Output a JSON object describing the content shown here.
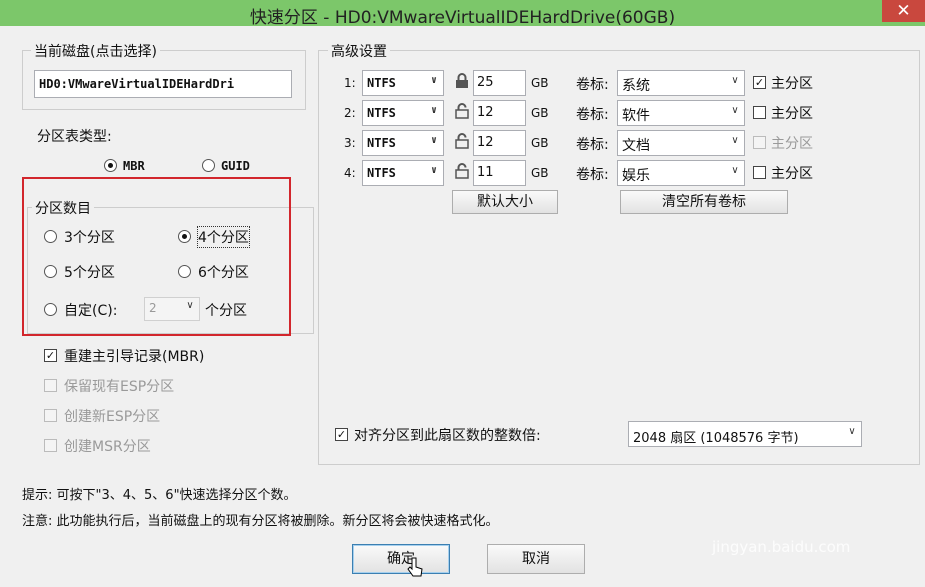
{
  "window": {
    "title": "快速分区 - HD0:VMwareVirtualIDEHardDrive(60GB)",
    "close_glyph": "✕"
  },
  "disk": {
    "legend": "当前磁盘(点击选择)",
    "value": "HD0:VMwareVirtualIDEHardDri"
  },
  "table_type": {
    "label": "分区表类型:",
    "options": [
      "MBR",
      "GUID"
    ],
    "selected": "MBR"
  },
  "count": {
    "legend": "分区数目",
    "opt3": "3个分区",
    "opt4": "4个分区",
    "opt5": "5个分区",
    "opt6": "6个分区",
    "custom": "自定(C):",
    "custom_value": "2",
    "custom_suffix": "个分区",
    "selected": "4个分区"
  },
  "options": {
    "rebuild_mbr": {
      "label": "重建主引导记录(MBR)",
      "checked": true
    },
    "keep_esp": {
      "label": "保留现有ESP分区",
      "checked": false,
      "disabled": true
    },
    "new_esp": {
      "label": "创建新ESP分区",
      "checked": false,
      "disabled": true
    },
    "msr": {
      "label": "创建MSR分区",
      "checked": false,
      "disabled": true
    }
  },
  "advanced": {
    "legend": "高级设置",
    "unit": "GB",
    "volume_label": "卷标:",
    "primary_label": "主分区",
    "rows": [
      {
        "index": "1:",
        "fs": "NTFS",
        "size": "25",
        "label": "系统",
        "primary": true,
        "primary_disabled": false,
        "locked": true
      },
      {
        "index": "2:",
        "fs": "NTFS",
        "size": "12",
        "label": "软件",
        "primary": false,
        "primary_disabled": false,
        "locked": false
      },
      {
        "index": "3:",
        "fs": "NTFS",
        "size": "12",
        "label": "文档",
        "primary": false,
        "primary_disabled": true,
        "locked": false
      },
      {
        "index": "4:",
        "fs": "NTFS",
        "size": "11",
        "label": "娱乐",
        "primary": false,
        "primary_disabled": false,
        "locked": false
      }
    ],
    "default_size_btn": "默认大小",
    "clear_labels_btn": "清空所有卷标",
    "align": {
      "label": "对齐分区到此扇区数的整数倍:",
      "checked": true,
      "value": "2048 扇区 (1048576 字节)"
    }
  },
  "notes": {
    "tip": "提示: 可按下\"3、4、5、6\"快速选择分区个数。",
    "warn": "注意: 此功能执行后，当前磁盘上的现有分区将被删除。新分区将会被快速格式化。"
  },
  "buttons": {
    "ok": "确定",
    "cancel": "取消"
  },
  "watermark": "jingyan.baidu.com"
}
